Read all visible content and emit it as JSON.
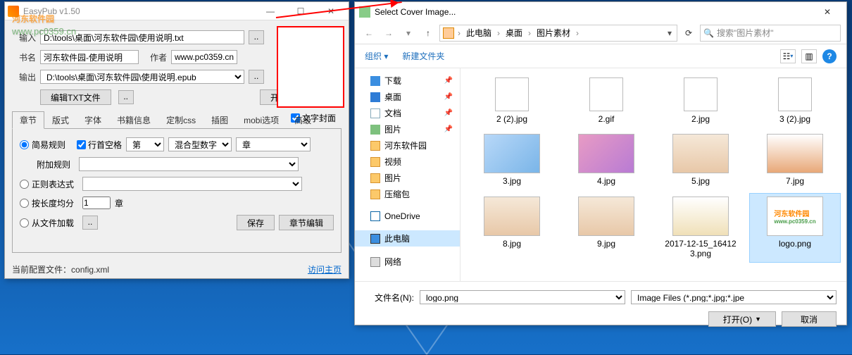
{
  "easypub": {
    "title": "EasyPub v1.50",
    "watermark": "河东软件园",
    "watermark_url": "www.pc0359.cn",
    "input_lbl": "输入",
    "input_val": "D:\\tools\\桌面\\河东软件园\\使用说明.txt",
    "book_lbl": "书名",
    "book_val": "河东软件园-使用说明",
    "author_lbl": "作者",
    "author_val": "www.pc0359.cn",
    "output_lbl": "输出",
    "output_val": "D:\\tools\\桌面\\河东软件园\\使用说明.epub",
    "edit_txt": "编辑TXT文件",
    "start": "开始转换",
    "text_cover": "文字封面",
    "tabs": [
      "章节",
      "版式",
      "字体",
      "书籍信息",
      "定制css",
      "插图",
      "mobi选项",
      "高级"
    ],
    "simple_rule": "简易规则",
    "line_space": "行首空格",
    "sel1": "第",
    "sel2": "混合型数字",
    "sel3": "章",
    "extra_rule": "附加规则",
    "regex": "正则表达式",
    "by_length": "按长度均分",
    "len_val": "1",
    "len_unit": "章",
    "from_file": "从文件加载",
    "save": "保存",
    "chapter_edit": "章节编辑",
    "config": "当前配置文件：",
    "config_file": "config.xml",
    "homepage": "访问主页"
  },
  "dlg": {
    "title": "Select Cover Image...",
    "bc": [
      "此电脑",
      "桌面",
      "图片素材"
    ],
    "search_ph": "搜索\"图片素材\"",
    "organize": "组织",
    "new_folder": "新建文件夹",
    "sidebar": [
      {
        "label": "下载",
        "cls": "dl",
        "pin": true
      },
      {
        "label": "桌面",
        "cls": "dk",
        "pin": true
      },
      {
        "label": "文档",
        "cls": "doc",
        "pin": true
      },
      {
        "label": "图片",
        "cls": "pic",
        "pin": true
      },
      {
        "label": "河东软件园",
        "cls": "fld"
      },
      {
        "label": "视频",
        "cls": "fld"
      },
      {
        "label": "图片",
        "cls": "fld"
      },
      {
        "label": "压缩包",
        "cls": "fld"
      }
    ],
    "onedrive": "OneDrive",
    "thispc": "此电脑",
    "network": "网络",
    "files": [
      {
        "name": "2 (2).jpg",
        "t": "ico"
      },
      {
        "name": "2.gif",
        "t": "ico"
      },
      {
        "name": "2.jpg",
        "t": "ico"
      },
      {
        "name": "3 (2).jpg",
        "t": "ico"
      },
      {
        "name": "3.jpg",
        "t": "anime"
      },
      {
        "name": "4.jpg",
        "t": "anime2"
      },
      {
        "name": "5.jpg",
        "t": "girl"
      },
      {
        "name": "7.jpg",
        "t": "girl2"
      },
      {
        "name": "8.jpg",
        "t": "girl"
      },
      {
        "name": "9.jpg",
        "t": "girl"
      },
      {
        "name": "2017-12-15_164123.png",
        "t": "dog"
      },
      {
        "name": "logo.png",
        "t": "logo",
        "sel": true
      }
    ],
    "fname_lbl": "文件名(N):",
    "fname_val": "logo.png",
    "filter": "Image Files (*.png;*.jpg;*.jpe",
    "open": "打开(O)",
    "cancel": "取消"
  }
}
